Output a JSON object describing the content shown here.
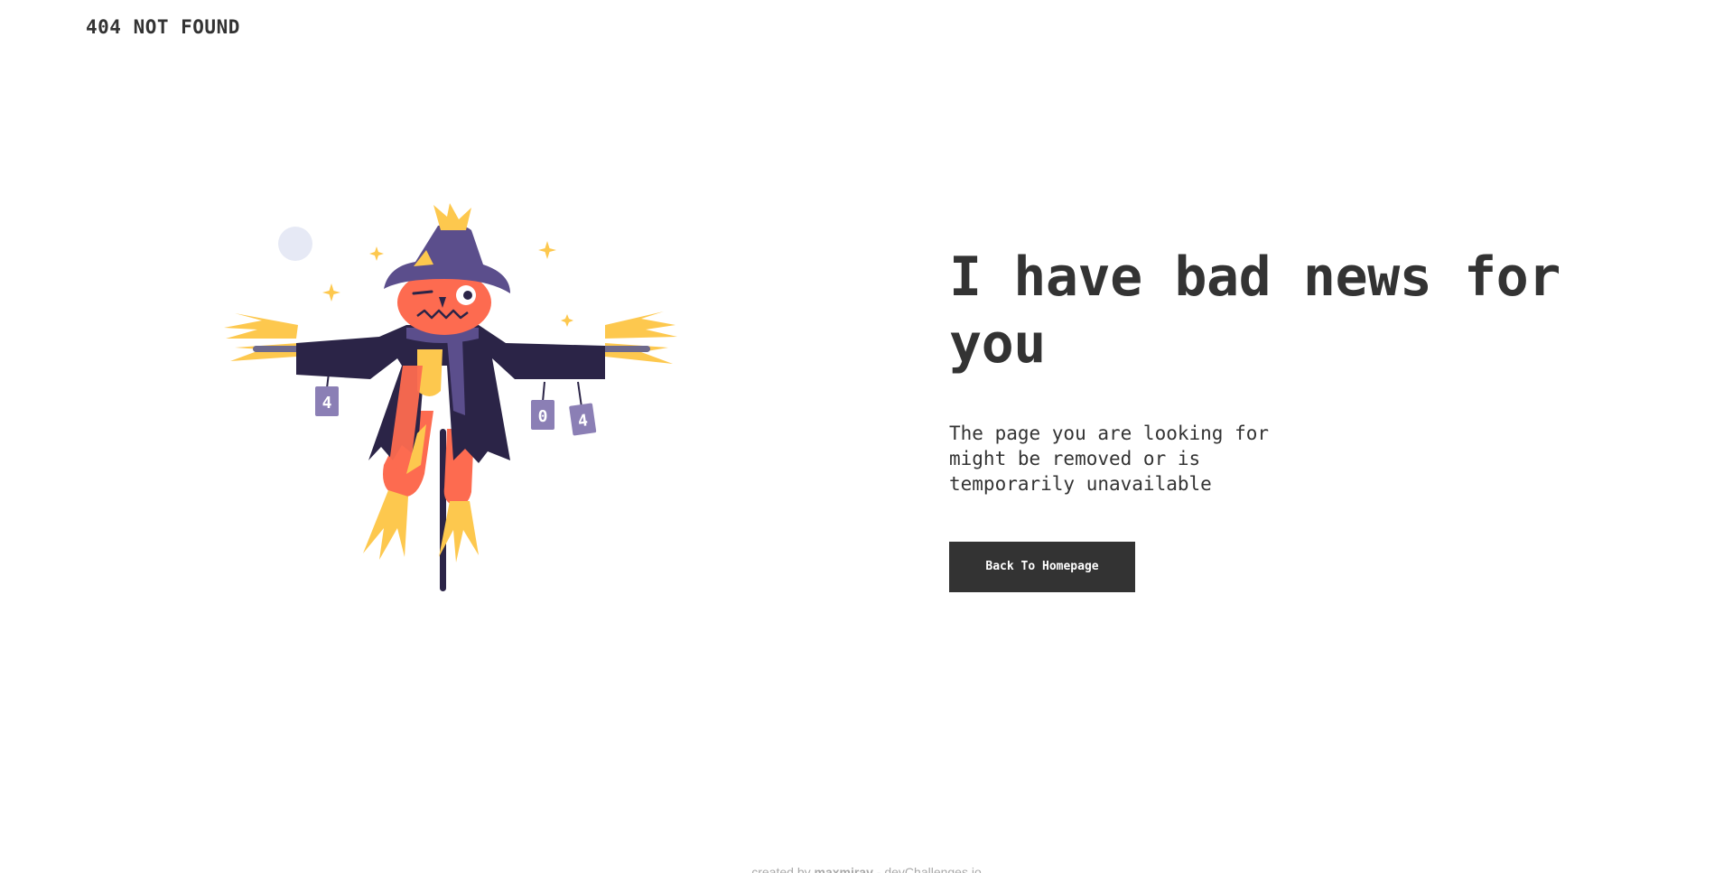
{
  "header": {
    "brand": "404 NOT FOUND"
  },
  "illustration": {
    "name": "scarecrow",
    "cans": [
      "4",
      "0",
      "4"
    ],
    "colors": {
      "hat": "#5b4e8c",
      "coat": "#2b2447",
      "face": "#fd6b50",
      "straw": "#fdc84e",
      "can": "#8b7fb5",
      "moon": "#e6e9f5",
      "pole": "#2b2447"
    }
  },
  "main": {
    "headline": "I have bad news for you",
    "message": "The page you are looking for might be removed or is temporarily unavailable",
    "button_label": "Back To Homepage"
  },
  "footer": {
    "prefix": "created by",
    "author": "maxmirav",
    "separator": "-",
    "site": "devChallenges.io"
  },
  "colors": {
    "text": "#333333",
    "button_bg": "#333333",
    "button_text": "#ffffff",
    "footer_text": "#a9a9a9"
  }
}
